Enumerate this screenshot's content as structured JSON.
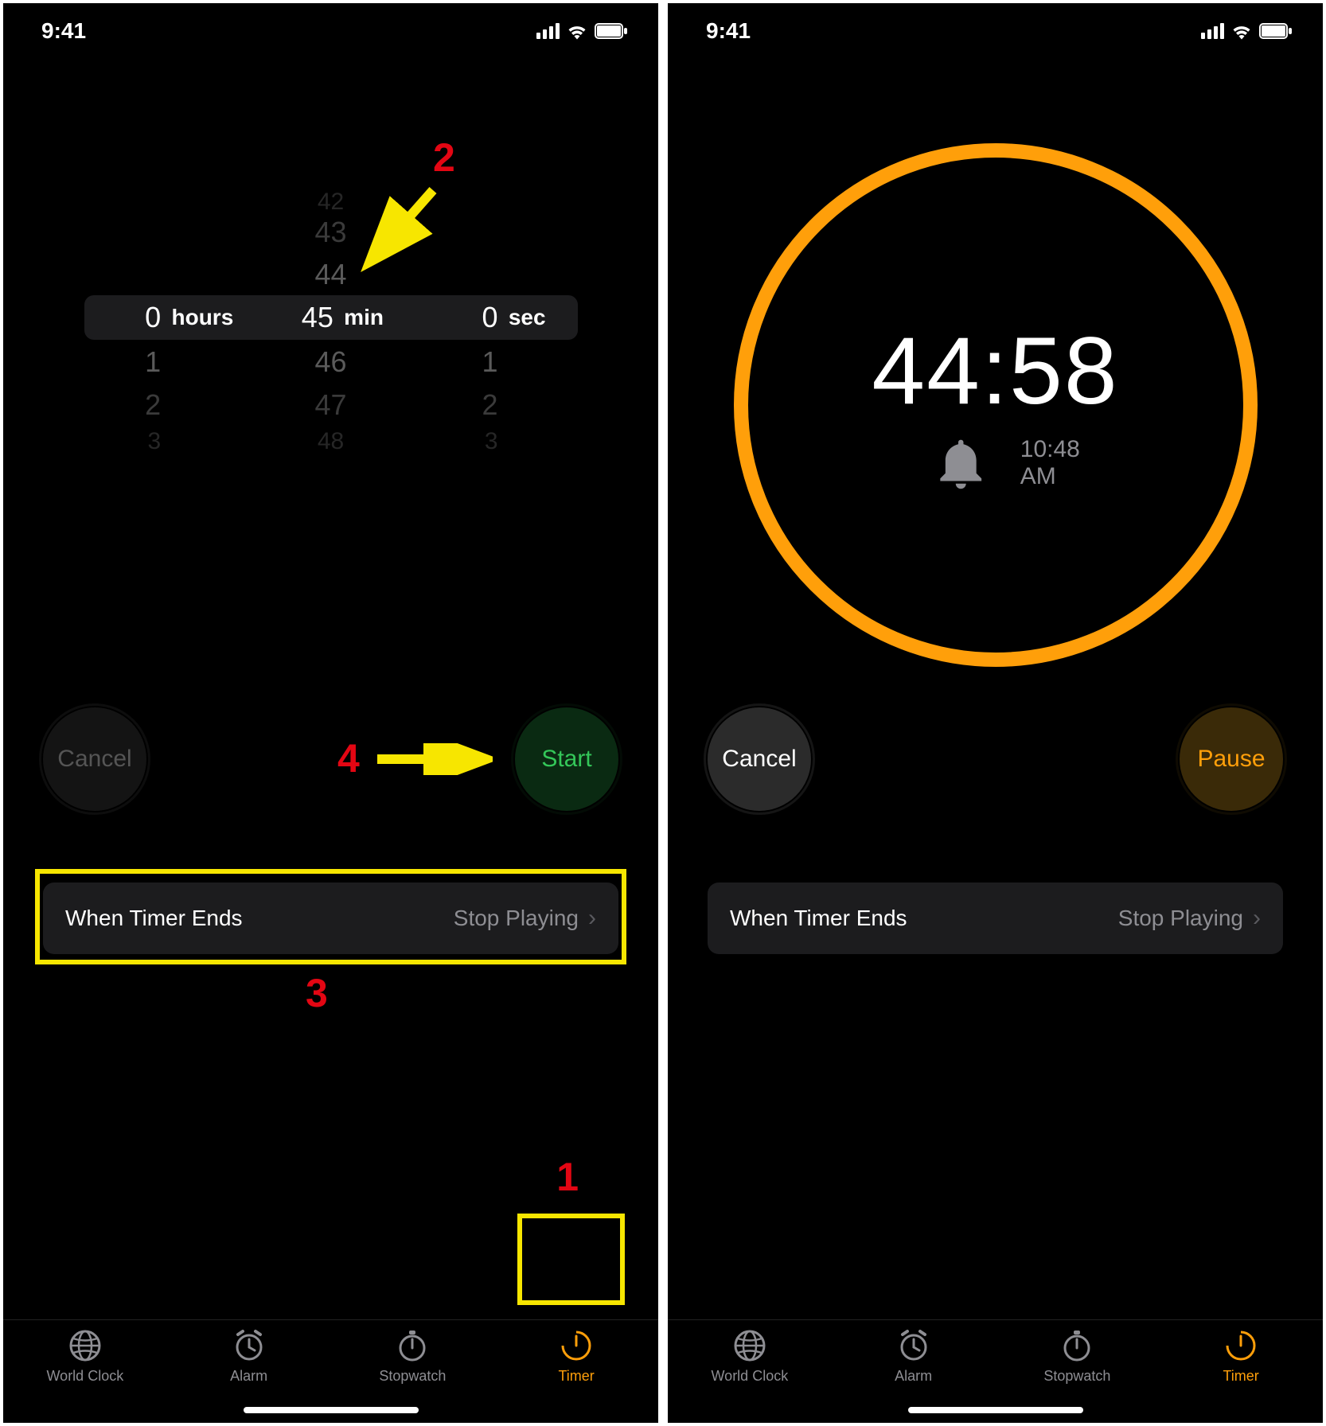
{
  "status": {
    "time": "9:41"
  },
  "left": {
    "picker": {
      "hours": {
        "selected": "0",
        "below": [
          "1",
          "2",
          "3"
        ],
        "label": "hours"
      },
      "minutes": {
        "above": [
          "42",
          "43",
          "44"
        ],
        "selected": "45",
        "below": [
          "46",
          "47",
          "48"
        ],
        "label": "min"
      },
      "seconds": {
        "selected": "0",
        "below": [
          "1",
          "2",
          "3"
        ],
        "label": "sec"
      }
    },
    "buttons": {
      "cancel": "Cancel",
      "start": "Start"
    },
    "ends": {
      "label": "When Timer Ends",
      "value": "Stop Playing"
    },
    "annotations": {
      "n1": "1",
      "n2": "2",
      "n3": "3",
      "n4": "4"
    }
  },
  "right": {
    "countdown": "44:58",
    "end_time": "10:48 AM",
    "buttons": {
      "cancel": "Cancel",
      "pause": "Pause"
    },
    "ends": {
      "label": "When Timer Ends",
      "value": "Stop Playing"
    }
  },
  "tabs": {
    "world": "World Clock",
    "alarm": "Alarm",
    "stopwatch": "Stopwatch",
    "timer": "Timer"
  }
}
